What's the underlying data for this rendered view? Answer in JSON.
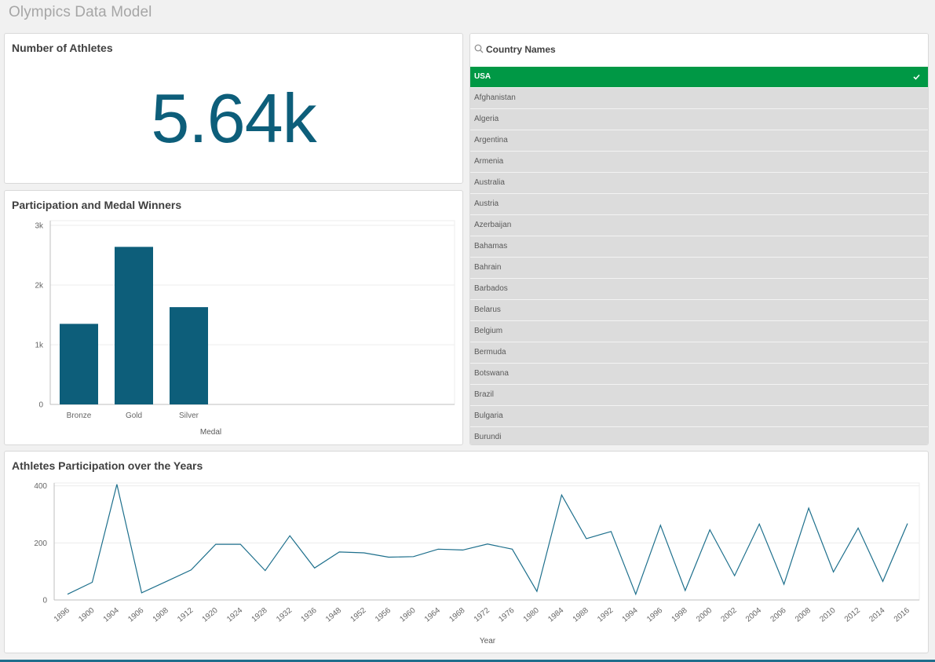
{
  "app": {
    "title": "Olympics Data Model"
  },
  "kpi": {
    "title": "Number of Athletes",
    "value": "5.64k"
  },
  "filter": {
    "label": "Country Names",
    "items": [
      {
        "label": "USA",
        "selected": true
      },
      {
        "label": "Afghanistan",
        "selected": false
      },
      {
        "label": "Algeria",
        "selected": false
      },
      {
        "label": "Argentina",
        "selected": false
      },
      {
        "label": "Armenia",
        "selected": false
      },
      {
        "label": "Australia",
        "selected": false
      },
      {
        "label": "Austria",
        "selected": false
      },
      {
        "label": "Azerbaijan",
        "selected": false
      },
      {
        "label": "Bahamas",
        "selected": false
      },
      {
        "label": "Bahrain",
        "selected": false
      },
      {
        "label": "Barbados",
        "selected": false
      },
      {
        "label": "Belarus",
        "selected": false
      },
      {
        "label": "Belgium",
        "selected": false
      },
      {
        "label": "Bermuda",
        "selected": false
      },
      {
        "label": "Botswana",
        "selected": false
      },
      {
        "label": "Brazil",
        "selected": false
      },
      {
        "label": "Bulgaria",
        "selected": false
      },
      {
        "label": "Burundi",
        "selected": false
      }
    ],
    "colors": {
      "selected": "#009845",
      "alternative": "#dcdcdc"
    }
  },
  "colors": {
    "accent": "#0d5e7a",
    "line": "#1d6f8c"
  },
  "chart_data": [
    {
      "type": "bar",
      "title": "Participation and Medal Winners",
      "categories": [
        "Bronze",
        "Gold",
        "Silver"
      ],
      "values": [
        1350,
        2640,
        1630
      ],
      "xlabel": "Medal",
      "ylabel": "",
      "ylim": [
        0,
        3000
      ],
      "yticks": [
        {
          "value": 0,
          "label": "0"
        },
        {
          "value": 1000,
          "label": "1k"
        },
        {
          "value": 2000,
          "label": "2k"
        },
        {
          "value": 3000,
          "label": "3k"
        }
      ],
      "grid": true
    },
    {
      "type": "line",
      "title": "Athletes Participation over the Years",
      "x": [
        "1896",
        "1900",
        "1904",
        "1906",
        "1908",
        "1912",
        "1920",
        "1924",
        "1928",
        "1932",
        "1936",
        "1948",
        "1952",
        "1956",
        "1960",
        "1964",
        "1968",
        "1972",
        "1976",
        "1980",
        "1984",
        "1988",
        "1992",
        "1994",
        "1996",
        "1998",
        "2000",
        "2002",
        "2004",
        "2006",
        "2008",
        "2010",
        "2012",
        "2014",
        "2016"
      ],
      "values": [
        20,
        62,
        405,
        25,
        65,
        105,
        195,
        195,
        103,
        225,
        112,
        168,
        165,
        150,
        152,
        178,
        175,
        196,
        178,
        30,
        368,
        215,
        240,
        20,
        262,
        33,
        246,
        85,
        266,
        55,
        322,
        98,
        252,
        65,
        268
      ],
      "xlabel": "Year",
      "ylabel": "",
      "ylim": [
        0,
        410
      ],
      "yticks": [
        {
          "value": 0,
          "label": "0"
        },
        {
          "value": 200,
          "label": "200"
        },
        {
          "value": 400,
          "label": "400"
        }
      ],
      "grid": true
    }
  ]
}
